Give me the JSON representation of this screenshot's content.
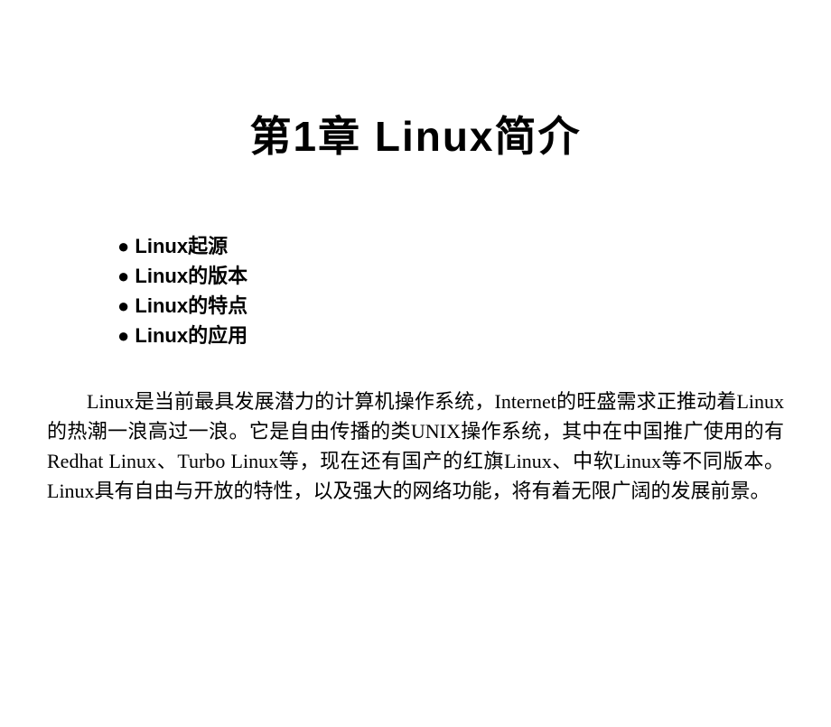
{
  "title": "第1章 Linux简介",
  "bullets": [
    "Linux起源",
    "Linux的版本",
    "Linux的特点",
    "Linux的应用"
  ],
  "paragraph": "Linux是当前最具发展潜力的计算机操作系统，Internet的旺盛需求正推动着Linux的热潮一浪高过一浪。它是自由传播的类UNIX操作系统，其中在中国推广使用的有Redhat Linux、Turbo Linux等，现在还有国产的红旗Linux、中软Linux等不同版本。Linux具有自由与开放的特性，以及强大的网络功能，将有着无限广阔的发展前景。"
}
